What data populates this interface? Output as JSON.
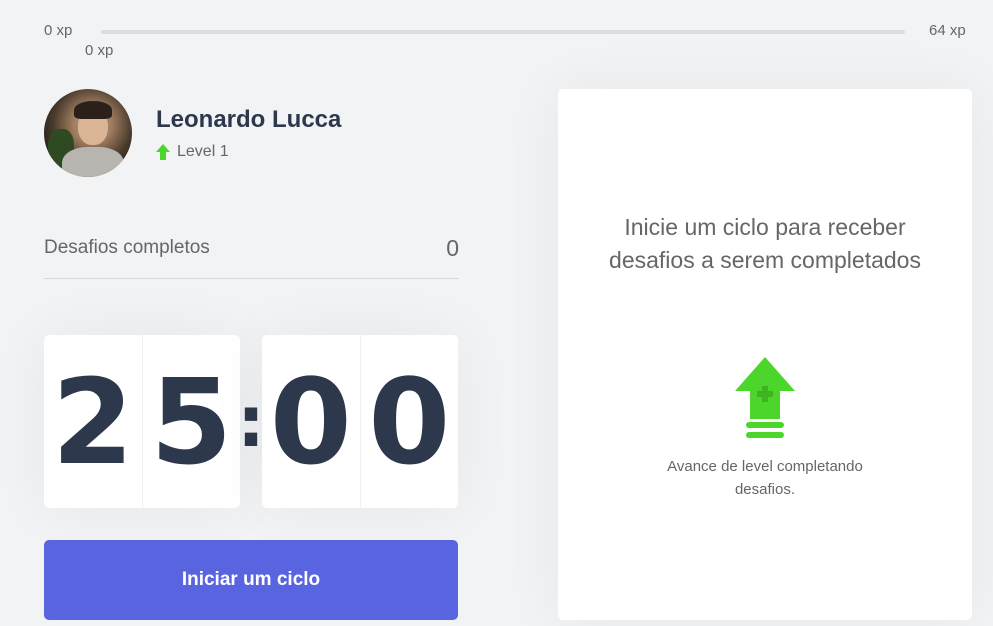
{
  "xp_bar": {
    "min_label": "0 xp",
    "max_label": "64 xp",
    "current_label": "0 xp",
    "progress_fraction": 0,
    "fill_color": "#4cd62b"
  },
  "profile": {
    "name": "Leonardo Lucca",
    "level_label": "Level 1",
    "level_icon": "level-up-arrow-icon"
  },
  "challenges": {
    "label": "Desafios completos",
    "count": "0"
  },
  "countdown": {
    "minute_left": "2",
    "minute_right": "5",
    "separator": ":",
    "second_left": "0",
    "second_right": "0"
  },
  "start_button": {
    "label": "Iniciar um ciclo",
    "color": "#5965e0"
  },
  "challenge_card": {
    "title": "Inicie um ciclo para receber desafios a serem completados",
    "icon": "level-up-icon",
    "description": "Avance de level completando desafios."
  },
  "colors": {
    "background": "#f2f3f5",
    "title_text": "#2e384d",
    "body_text": "#666666",
    "green": "#4cd62b"
  }
}
